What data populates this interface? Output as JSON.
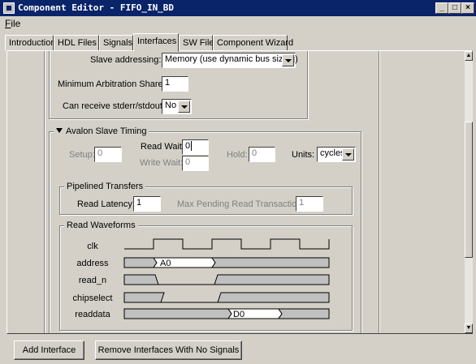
{
  "window": {
    "title": "Component Editor - FIFO_IN_BD",
    "minimize": "_",
    "maximize": "□",
    "close": "×"
  },
  "menu": {
    "file_u": "F",
    "file_rest": "ile"
  },
  "tabs": [
    "Introduction",
    "HDL Files",
    "Signals",
    "Interfaces",
    "SW Files",
    "Component Wizard"
  ],
  "active_tab": "Interfaces",
  "slave": {
    "addressing_label": "Slave addressing:",
    "addressing_value": "Memory (use dynamic bus sizing)",
    "arbitration_label": "Minimum Arbitration Shares:",
    "arbitration_value": "1",
    "stderr_label": "Can receive stderr/stdout:",
    "stderr_value": "No"
  },
  "timing": {
    "title": "Avalon Slave  Timing",
    "setup_label": "Setup:",
    "setup_value": "0",
    "read_wait_label": "Read Wait:",
    "read_wait_value": "0",
    "write_wait_label": "Write Wait:",
    "write_wait_value": "0",
    "hold_label": "Hold:",
    "hold_value": "0",
    "units_label": "Units:",
    "units_value": "cycles"
  },
  "pipelined": {
    "title": "Pipelined Transfers",
    "latency_label": "Read Latency:",
    "latency_value": "1",
    "max_pending_label": "Max Pending Read Transactions:",
    "max_pending_value": "1"
  },
  "waveforms": {
    "title": "Read Waveforms",
    "signals": [
      "clk",
      "address",
      "read_n",
      "chipselect",
      "readdata"
    ],
    "address_value": "A0",
    "readdata_value": "D0"
  },
  "buttons": {
    "add_interface": "Add Interface",
    "remove_interfaces": "Remove Interfaces With No Signals"
  },
  "scrollbar": {
    "up": "▲",
    "down": "▼"
  },
  "colors": {
    "titlebar": "#0a246a",
    "face": "#d4d0c8",
    "waveform_fill": "#c0c0c0"
  }
}
